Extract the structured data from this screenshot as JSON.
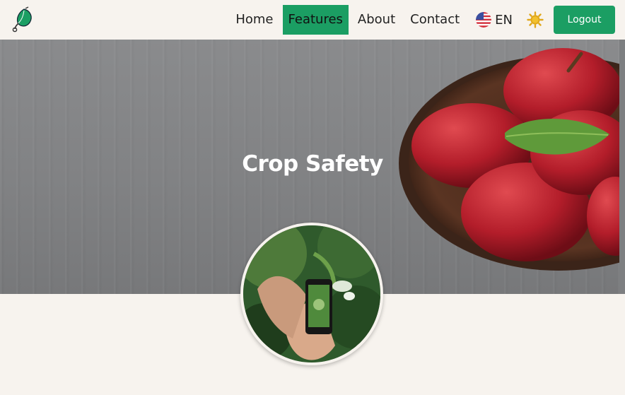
{
  "nav": {
    "links": [
      {
        "label": "Home"
      },
      {
        "label": "Features"
      },
      {
        "label": "About"
      },
      {
        "label": "Contact"
      }
    ],
    "active": "Features",
    "language": "EN",
    "logout_label": "Logout"
  },
  "hero": {
    "title": "Crop Safety"
  },
  "colors": {
    "accent": "#1b9e63",
    "background": "#f7f3ee",
    "sun": "#e0a81c"
  },
  "icons": [
    "leaf-logo-icon",
    "us-flag-icon",
    "sun-icon"
  ]
}
